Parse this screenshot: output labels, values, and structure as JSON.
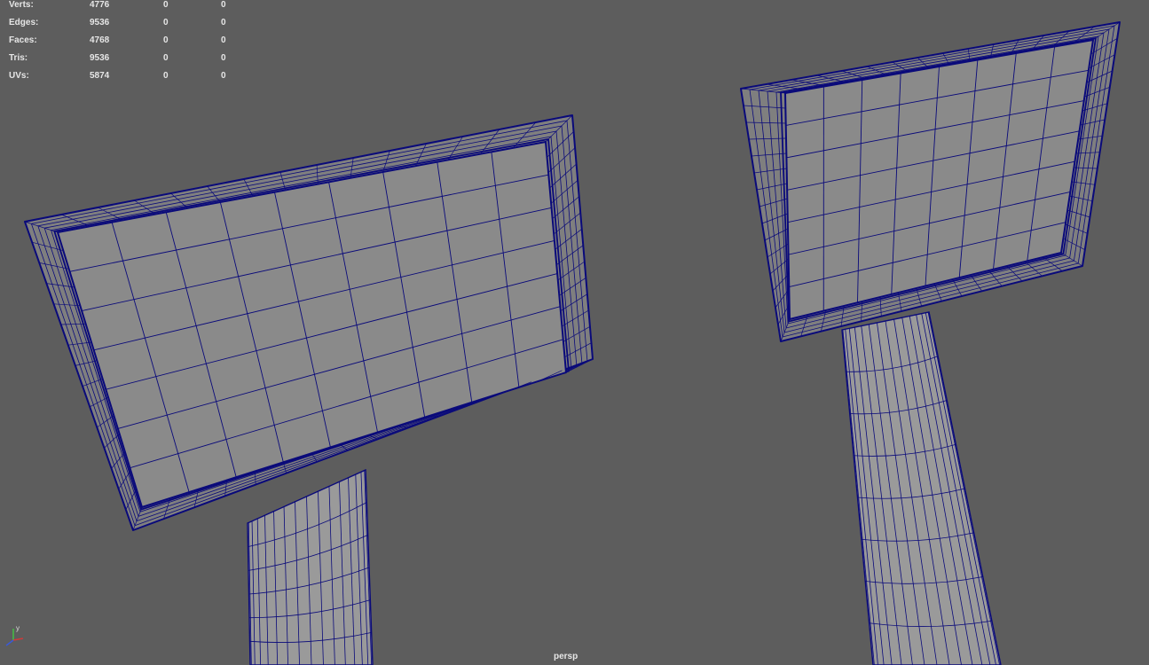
{
  "hud": {
    "rows": [
      {
        "label": "Verts:",
        "total": "4776",
        "selected": "0",
        "component": "0"
      },
      {
        "label": "Edges:",
        "total": "9536",
        "selected": "0",
        "component": "0"
      },
      {
        "label": "Faces:",
        "total": "4768",
        "selected": "0",
        "component": "0"
      },
      {
        "label": "Tris:",
        "total": "9536",
        "selected": "0",
        "component": "0"
      },
      {
        "label": "UVs:",
        "total": "5874",
        "selected": "0",
        "component": "0"
      }
    ]
  },
  "viewport": {
    "camera": "persp",
    "background_color": "#5d5d5d",
    "mesh_fill_color": "#8a8a8a",
    "wire_color": "#0a0a7a",
    "axis_labels": {
      "y": "y",
      "x": "x",
      "z": "z"
    },
    "axis_icon": "xyz-axis-gizmo-icon"
  }
}
